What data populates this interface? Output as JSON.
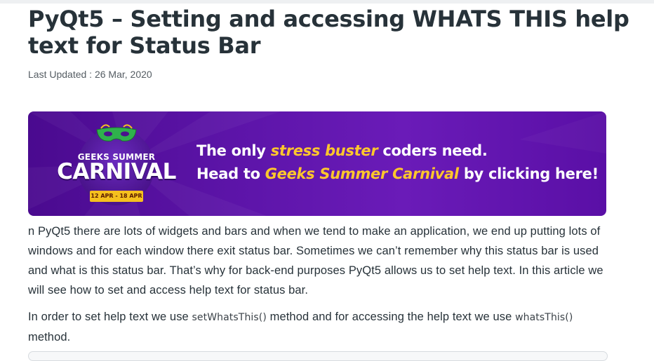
{
  "article": {
    "title": "PyQt5 – Setting and accessing WHATS THIS help text for Status Bar",
    "last_updated": "Last Updated : 26 Mar, 2020"
  },
  "banner": {
    "logo_top": "GEEKS SUMMER",
    "logo_main": "CARNIVAL",
    "logo_dates": "12 APR - 18 APR",
    "line1_a": "The only ",
    "line1_hl": "stress buster",
    "line1_b": " coders need.",
    "line2_a": "Head to ",
    "line2_hl": "Geeks Summer Carnival",
    "line2_b": " by clicking here!",
    "colors": {
      "bg": "#5c14a8",
      "highlight": "#ffc72c"
    }
  },
  "paragraph1": "n PyQt5 there are lots of widgets and bars and when we tend to make an application, we end up putting lots of windows and for each window there exit status bar. Sometimes we can’t remember why this status bar is used and what is this status bar. That’s why for back-end purposes PyQt5 allows us to set help text. In this article we will see how to set and access help text for status bar.",
  "paragraph2": {
    "part1": "In order to set help text we use ",
    "code1": "setWhatsThis()",
    "part2": " method and for accessing the help text we use ",
    "code2": "whatsThis()",
    "part3": " method."
  }
}
